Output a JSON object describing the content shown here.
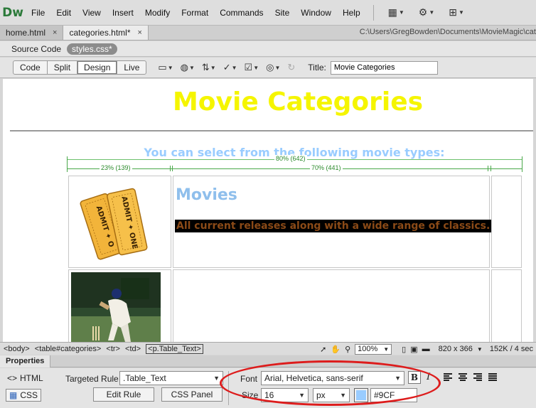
{
  "app": {
    "logo": "Dw"
  },
  "menu": [
    "File",
    "Edit",
    "View",
    "Insert",
    "Modify",
    "Format",
    "Commands",
    "Site",
    "Window",
    "Help"
  ],
  "tabs": [
    {
      "label": "home.html",
      "close": "×"
    },
    {
      "label": "categories.html*",
      "close": "×"
    }
  ],
  "file_path": "C:\\Users\\GregBowden\\Documents\\MovieMagic\\cat",
  "related": {
    "source": "Source Code",
    "css": "styles.css*"
  },
  "view_buttons": [
    "Code",
    "Split",
    "Design",
    "Live"
  ],
  "title_field": {
    "label": "Title:",
    "value": "Movie Categories"
  },
  "canvas": {
    "heading": "Movie Categories",
    "subheading": "You can select from the following movie types:",
    "table_width": "80% (642)",
    "col1_width": "23% (139)",
    "col2_width": "70% (441)",
    "category_title": "Movies",
    "category_text": "All current releases along with a wide range of classics."
  },
  "status": {
    "tags": [
      "<body>",
      "<table#categories>",
      "<tr>",
      "<td>",
      "<p.Table_Text>"
    ],
    "zoom": "100%",
    "dimensions": "820 x 366",
    "download": "152K / 4 sec"
  },
  "properties": {
    "title": "Properties",
    "html_btn": "HTML",
    "css_btn": "CSS",
    "targeted_rule_label": "Targeted Rule",
    "targeted_rule": ".Table_Text",
    "edit_rule": "Edit Rule",
    "css_panel": "CSS Panel",
    "font_label": "Font",
    "font": "Arial, Helvetica, sans-serif",
    "bold": "B",
    "italic": "I",
    "size_label": "Size",
    "size": "16",
    "unit": "px",
    "color": "#9CF"
  },
  "colors": {
    "heading": "#f5f500",
    "subheading": "#99ccff",
    "category_title": "#8fbfec",
    "annotation": "#dd1c1c"
  }
}
